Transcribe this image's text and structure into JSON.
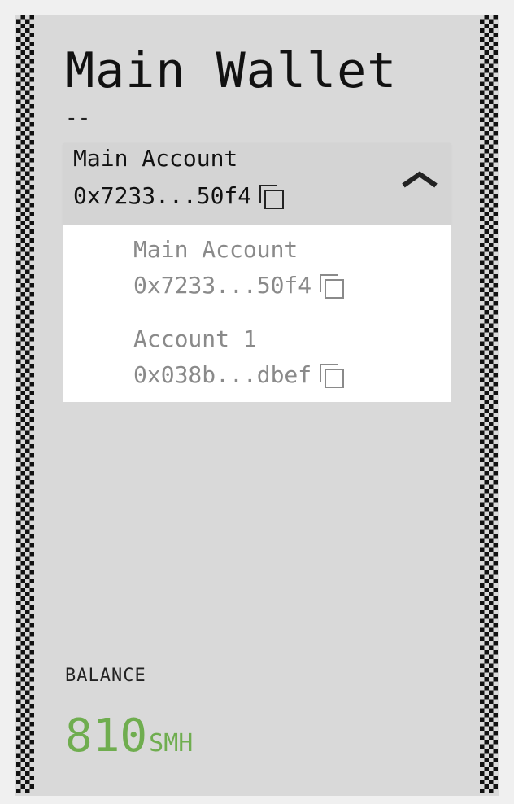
{
  "wallet": {
    "title": "Main Wallet",
    "subtitle": "--"
  },
  "selected_account": {
    "name": "Main Account",
    "address": "0x7233...50f4",
    "expanded": true
  },
  "accounts": [
    {
      "name": "Main Account",
      "address": "0x7233...50f4"
    },
    {
      "name": "Account 1",
      "address": "0x038b...dbef"
    }
  ],
  "balance": {
    "label": "BALANCE",
    "amount": "810",
    "unit": "SMH"
  },
  "colors": {
    "panel_bg": "#d9d9d9",
    "balance_green": "#6fad4f",
    "muted_text": "#8a8a8a"
  },
  "icons": {
    "copy": "copy-icon",
    "collapse": "chevron-up-icon"
  }
}
